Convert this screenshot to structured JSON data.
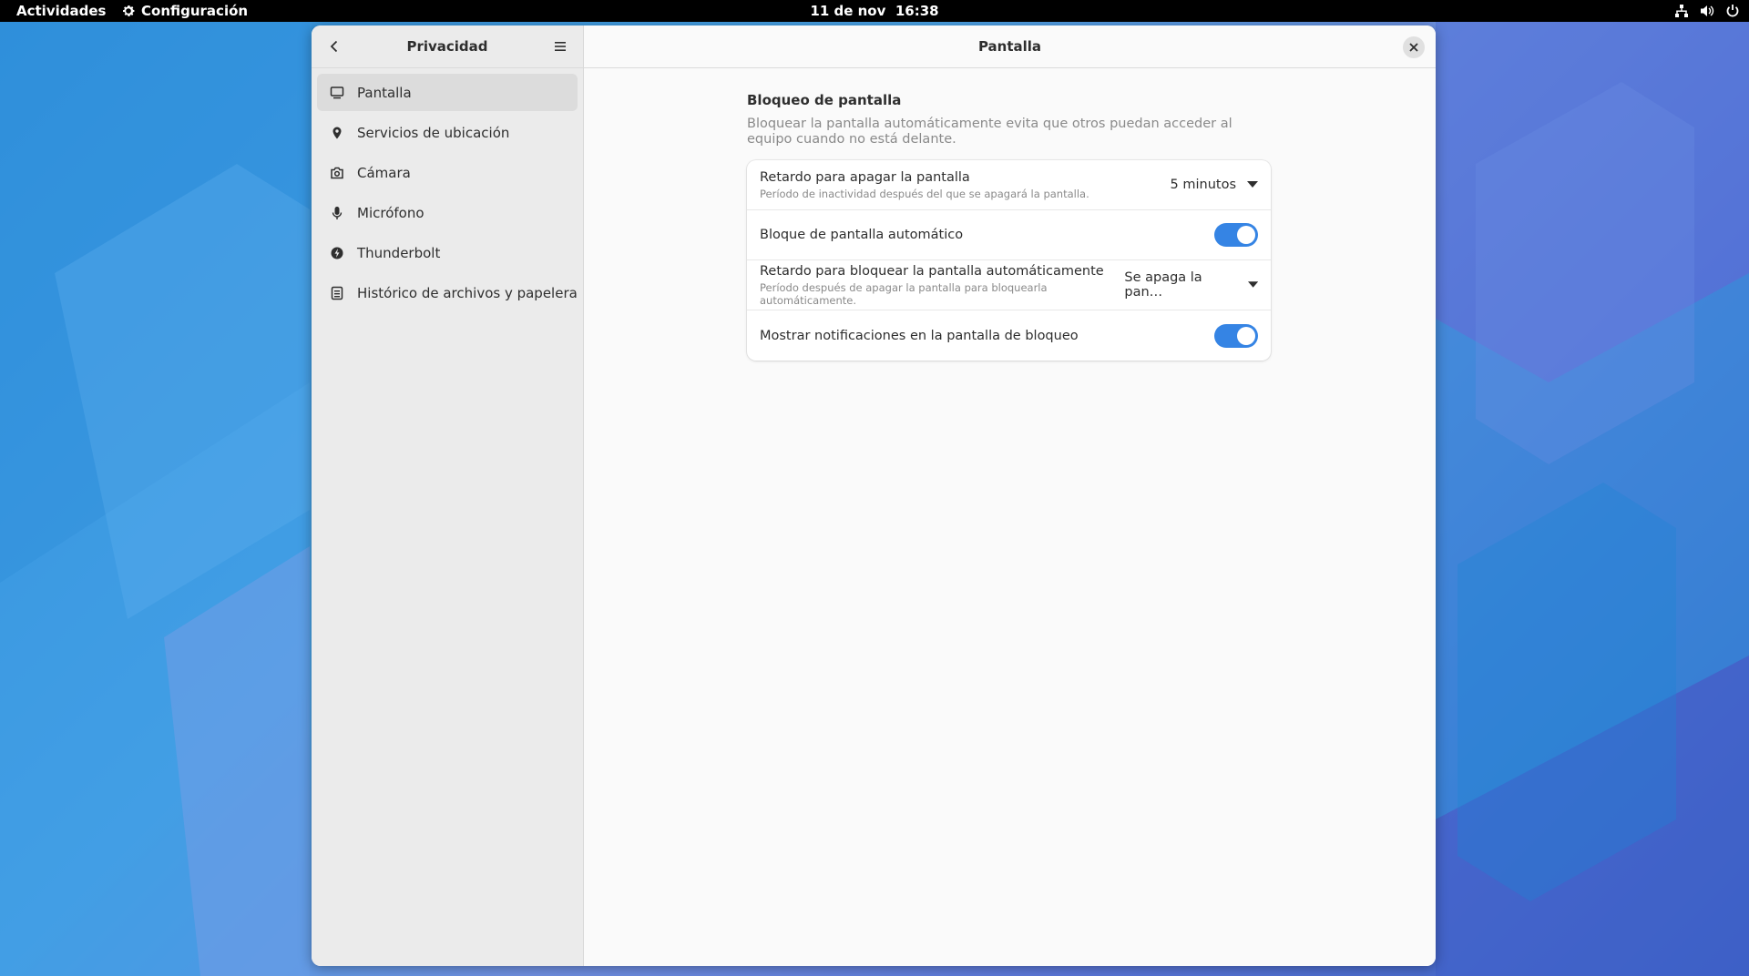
{
  "topbar": {
    "activities": "Actividades",
    "app_name": "Configuración",
    "date": "11 de nov",
    "time": "16:38",
    "tray_icons": [
      "network-icon",
      "volume-icon",
      "power-icon"
    ]
  },
  "sidebar": {
    "title": "Privacidad",
    "items": [
      {
        "label": "Pantalla",
        "icon": "display-icon",
        "active": true
      },
      {
        "label": "Servicios de ubicación",
        "icon": "location-icon",
        "active": false
      },
      {
        "label": "Cámara",
        "icon": "camera-icon",
        "active": false
      },
      {
        "label": "Micrófono",
        "icon": "microphone-icon",
        "active": false
      },
      {
        "label": "Thunderbolt",
        "icon": "thunderbolt-icon",
        "active": false
      },
      {
        "label": "Histórico de archivos y papelera",
        "icon": "file-history-icon",
        "active": false
      }
    ]
  },
  "content": {
    "title": "Pantalla",
    "section": {
      "title": "Bloqueo de pantalla",
      "description": "Bloquear la pantalla automáticamente evita que otros puedan acceder al equipo cuando no está delante."
    },
    "rows": {
      "blank_delay": {
        "title": "Retardo para apagar la pantalla",
        "subtitle": "Período de inactividad después del que se apagará la pantalla.",
        "value": "5 minutos"
      },
      "auto_lock": {
        "title": "Bloque de pantalla automático",
        "enabled": true
      },
      "lock_delay": {
        "title": "Retardo para bloquear la pantalla automáticamente",
        "subtitle": "Período después de apagar la pantalla para bloquearla automáticamente.",
        "value": "Se apaga la pan…"
      },
      "notifications": {
        "title": "Mostrar notificaciones en la pantalla de bloqueo",
        "enabled": true
      }
    }
  },
  "colors": {
    "accent": "#3584e4",
    "topbar": "#000000",
    "sidebar_bg": "#ebebeb",
    "content_bg": "#fafafa"
  }
}
